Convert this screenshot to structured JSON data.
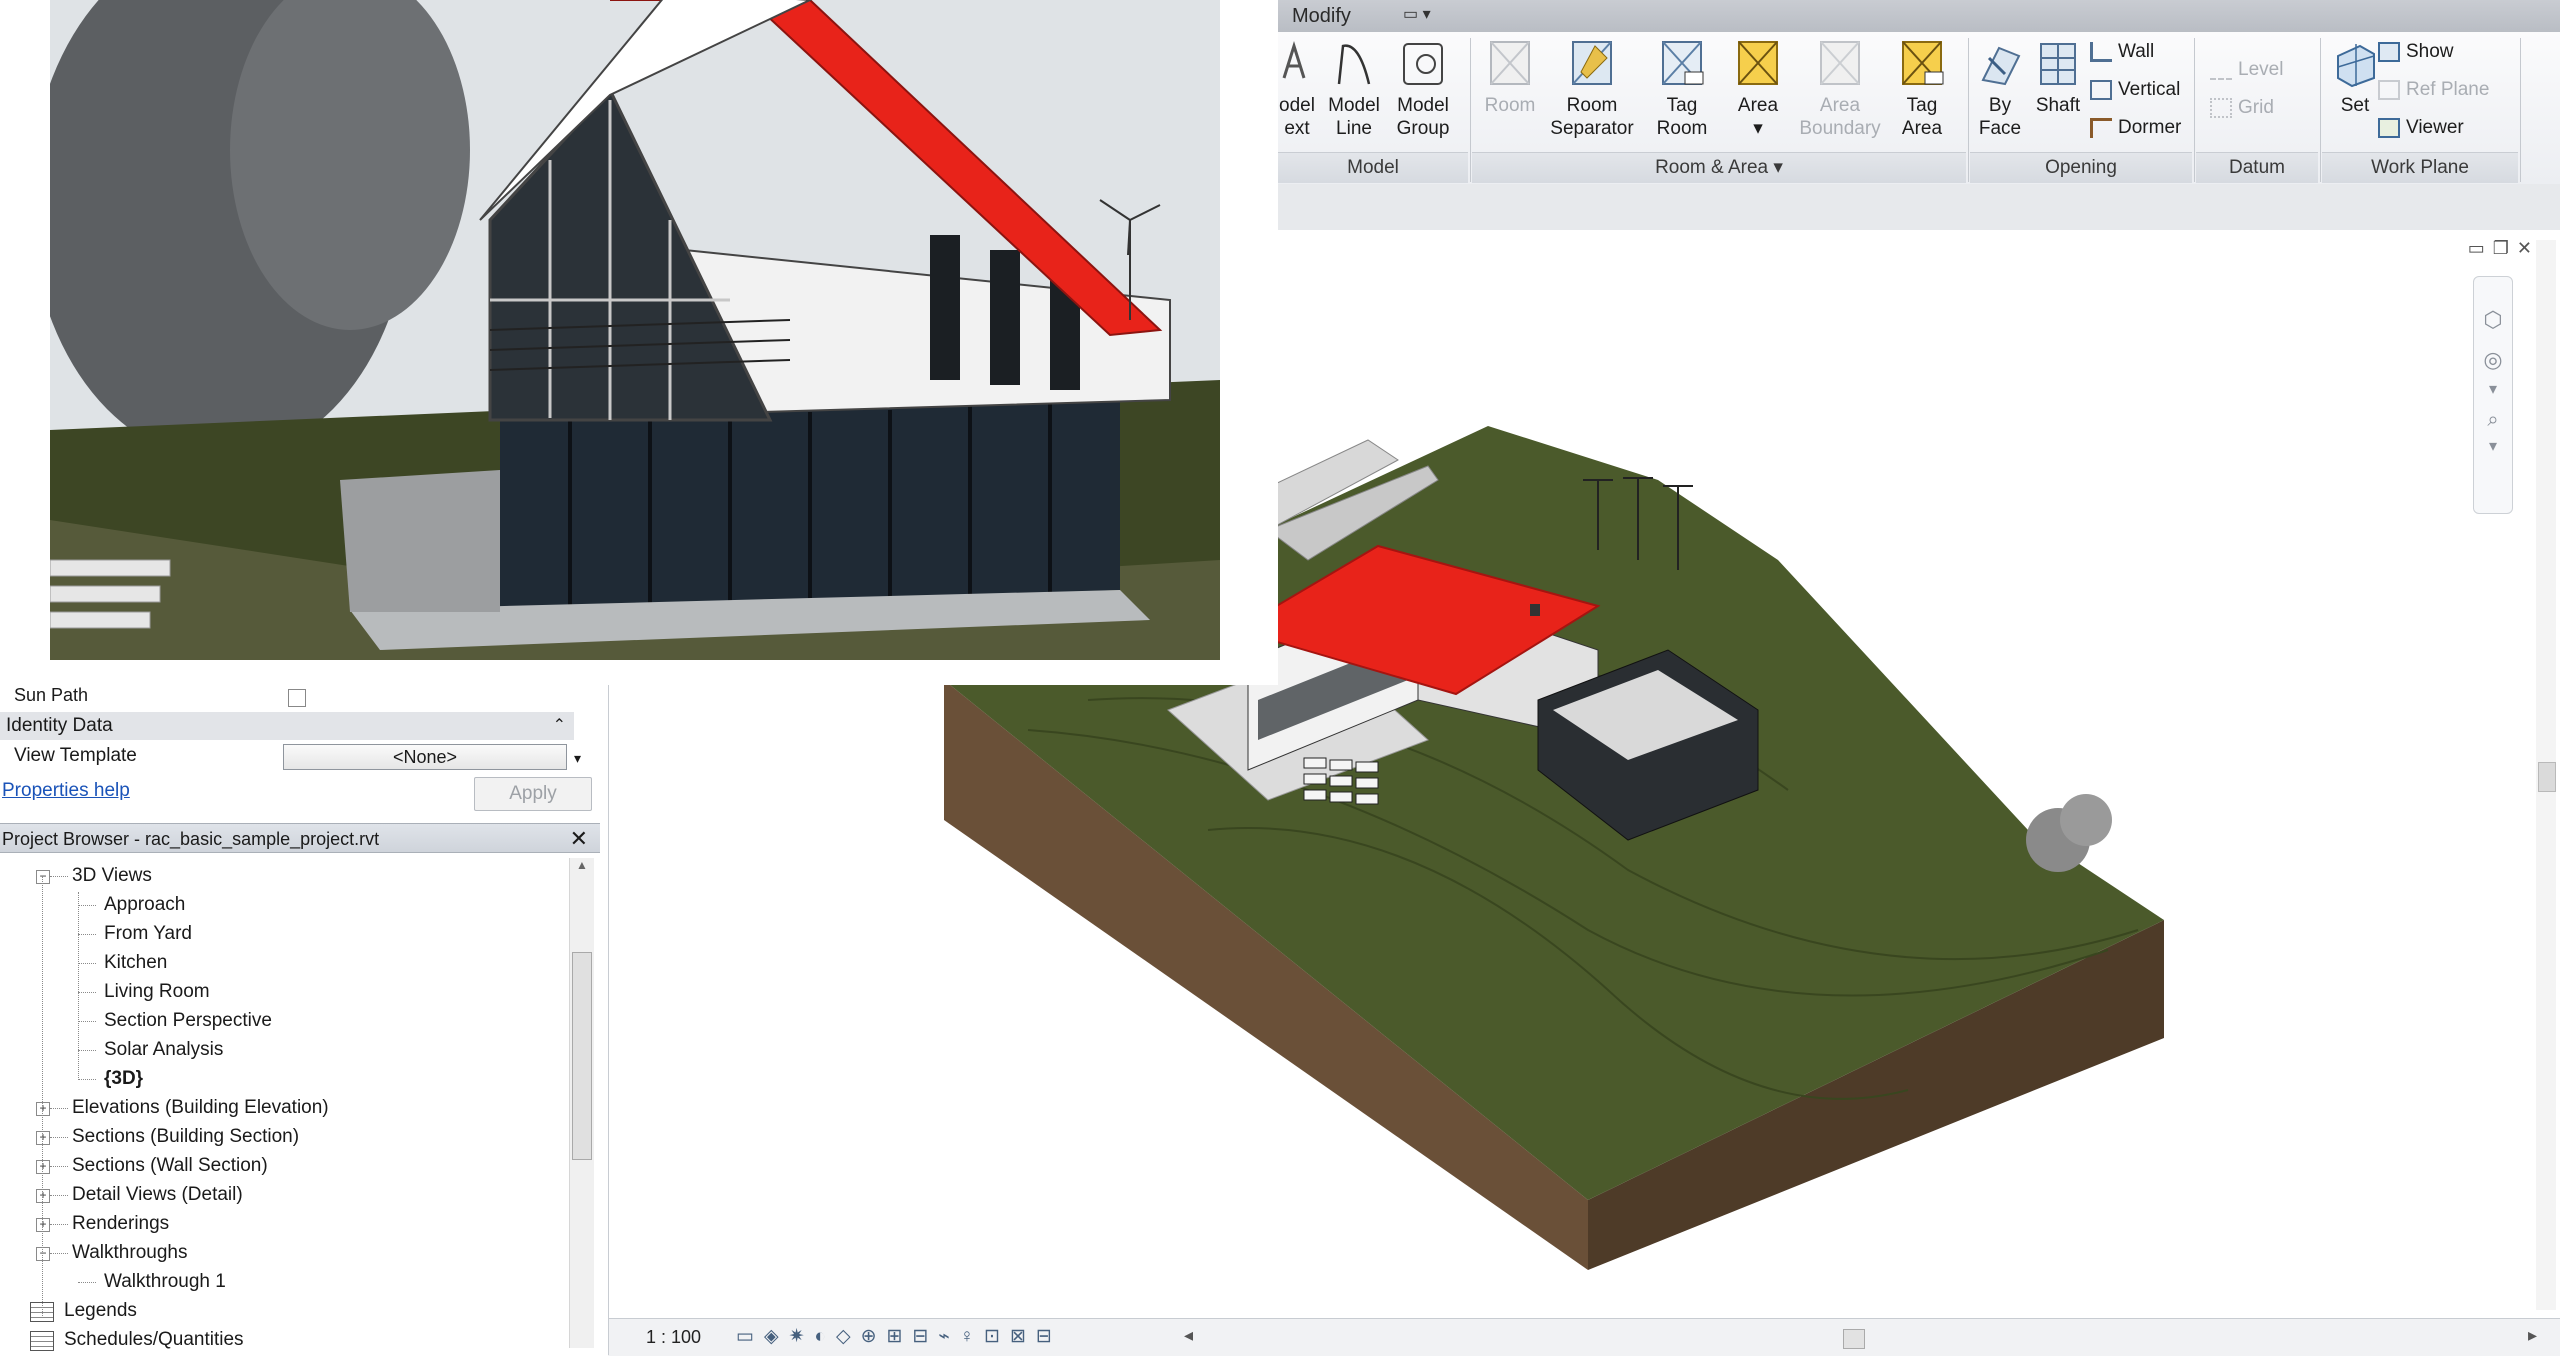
{
  "ribbon": {
    "tabs": [
      {
        "label": "Modify"
      }
    ],
    "panels": [
      {
        "title": "Model"
      },
      {
        "title": "Room & Area"
      },
      {
        "title": "Opening"
      },
      {
        "title": "Datum"
      },
      {
        "title": "Work Plane"
      }
    ],
    "model": {
      "model_text": [
        "odel",
        "ext"
      ],
      "model_line": [
        "Model",
        "Line"
      ],
      "model_group": [
        "Model",
        "Group"
      ]
    },
    "room_area": {
      "room": "Room",
      "room_separator": [
        "Room",
        "Separator"
      ],
      "tag_room": [
        "Tag",
        "Room"
      ],
      "area": "Area",
      "area_boundary": [
        "Area",
        "Boundary"
      ],
      "tag_area": [
        "Tag",
        "Area"
      ]
    },
    "opening": {
      "by_face": [
        "By",
        "Face"
      ],
      "shaft": "Shaft",
      "wall": "Wall",
      "vertical": "Vertical",
      "dormer": "Dormer"
    },
    "datum": {
      "level": "Level",
      "grid": "Grid"
    },
    "work_plane": {
      "set": "Set",
      "show": "Show",
      "ref_plane": "Ref Plane",
      "viewer": "Viewer"
    }
  },
  "properties": {
    "sun_path_label": "Sun Path",
    "identity_data": "Identity Data",
    "view_template_label": "View Template",
    "view_template_value": "<None>",
    "help_link": "Properties help",
    "apply": "Apply"
  },
  "project_browser": {
    "title": "Project Browser - rac_basic_sample_project.rvt",
    "items": [
      {
        "label": "3D Views",
        "level": 1,
        "expanded": true
      },
      {
        "label": "Approach",
        "level": 2
      },
      {
        "label": "From Yard",
        "level": 2
      },
      {
        "label": "Kitchen",
        "level": 2
      },
      {
        "label": "Living Room",
        "level": 2
      },
      {
        "label": "Section Perspective",
        "level": 2
      },
      {
        "label": "Solar Analysis",
        "level": 2
      },
      {
        "label": "{3D}",
        "level": 2,
        "bold": true
      },
      {
        "label": "Elevations (Building Elevation)",
        "level": 1,
        "expanded": false
      },
      {
        "label": "Sections (Building Section)",
        "level": 1,
        "expanded": false
      },
      {
        "label": "Sections (Wall Section)",
        "level": 1,
        "expanded": false
      },
      {
        "label": "Detail Views (Detail)",
        "level": 1,
        "expanded": false
      },
      {
        "label": "Renderings",
        "level": 1,
        "expanded": false
      },
      {
        "label": "Walkthroughs",
        "level": 1,
        "expanded": true
      },
      {
        "label": "Walkthrough 1",
        "level": 2
      },
      {
        "label": "Legends",
        "level": 0
      },
      {
        "label": "Schedules/Quantities",
        "level": 0
      }
    ]
  },
  "view": {
    "scale": "1 : 100"
  },
  "colors": {
    "roof": "#e8231a",
    "terrain": "#4b5a2b",
    "soil": "#5c4632",
    "ribbon_bg": "#f2f3f5"
  }
}
